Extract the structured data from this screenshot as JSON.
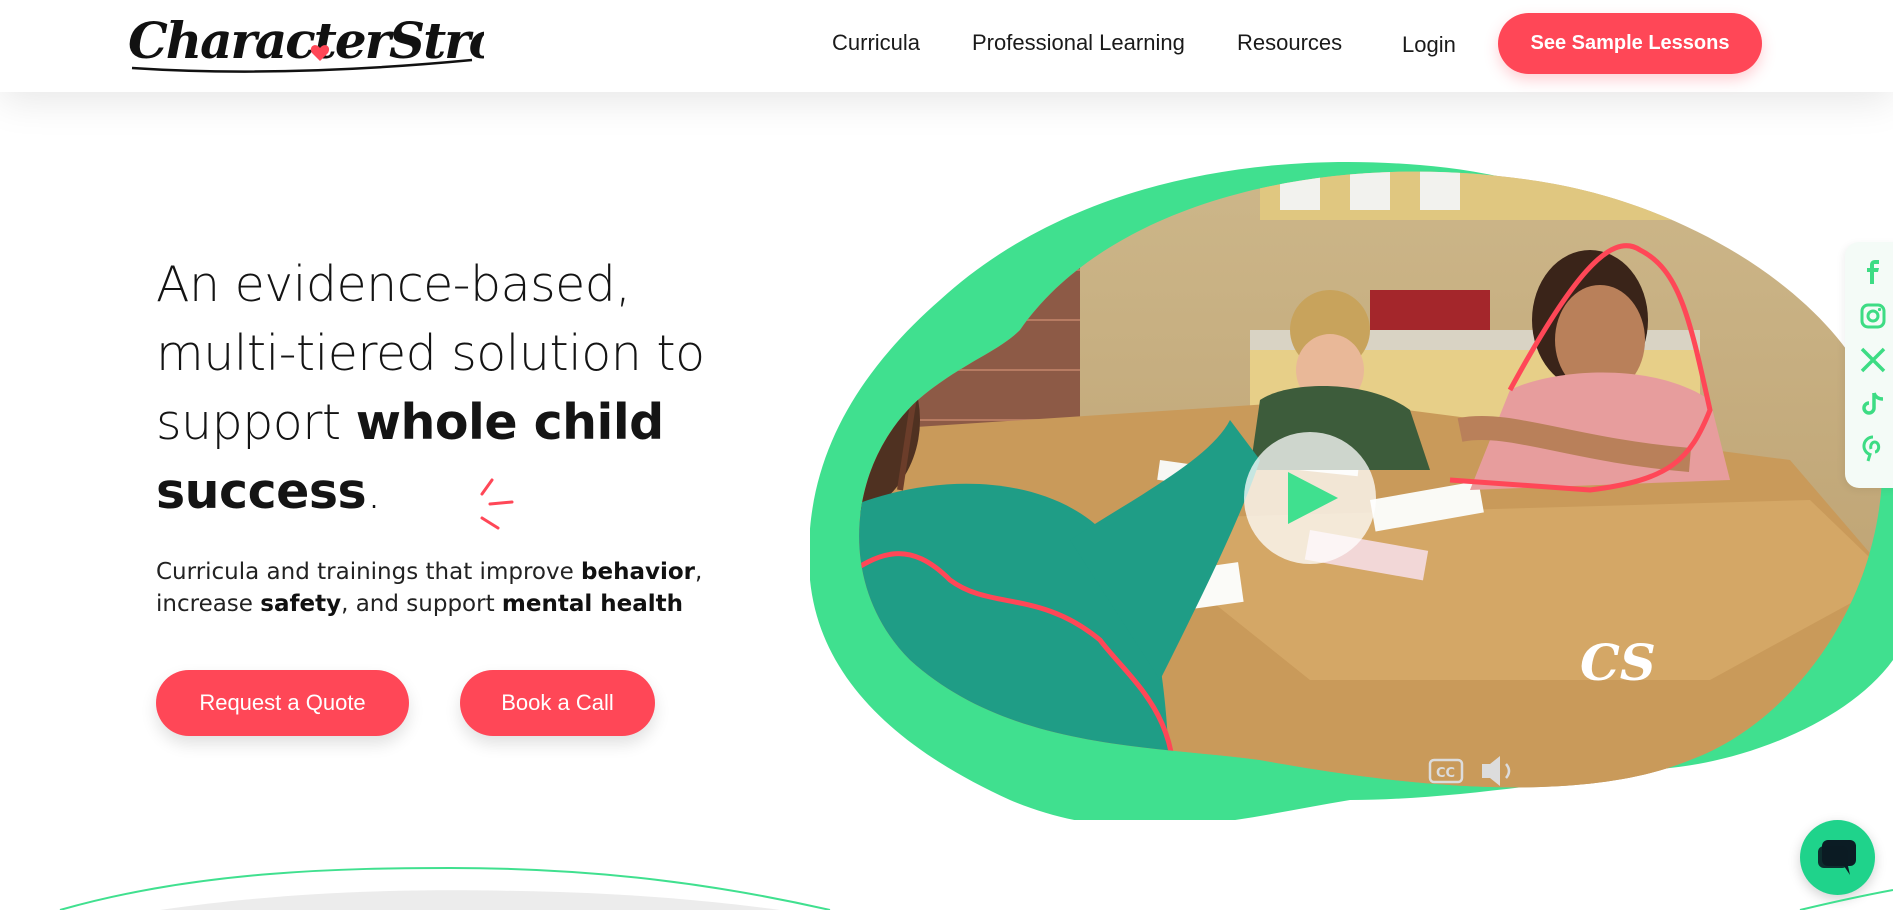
{
  "brand": {
    "logo_text": "CharacterStrong",
    "accent": "#ff4757",
    "green": "#3ddc84"
  },
  "nav": {
    "items": [
      {
        "label": "Curricula"
      },
      {
        "label": "Professional Learning"
      },
      {
        "label": "Resources"
      },
      {
        "label": "Login"
      }
    ],
    "cta_label": "See Sample Lessons"
  },
  "hero": {
    "headline_part1": "An evidence-based, multi-tiered solution to support ",
    "headline_bold": "whole child success",
    "headline_end": ".",
    "sub_1": "Curricula and trainings that improve ",
    "sub_bold_1": "behavior",
    "sub_2": ", increase ",
    "sub_bold_2": "safety",
    "sub_3": ", and support ",
    "sub_bold_3": "mental health",
    "button_quote": "Request a Quote",
    "button_call": "Book a Call"
  },
  "video": {
    "watermark": "CS",
    "controls": [
      "cc-icon",
      "volume-icon"
    ],
    "play_icon": "play-icon"
  },
  "socials": [
    "facebook-icon",
    "instagram-icon",
    "x-icon",
    "tiktok-icon",
    "pinterest-icon"
  ],
  "chat_icon": "chat-icon"
}
